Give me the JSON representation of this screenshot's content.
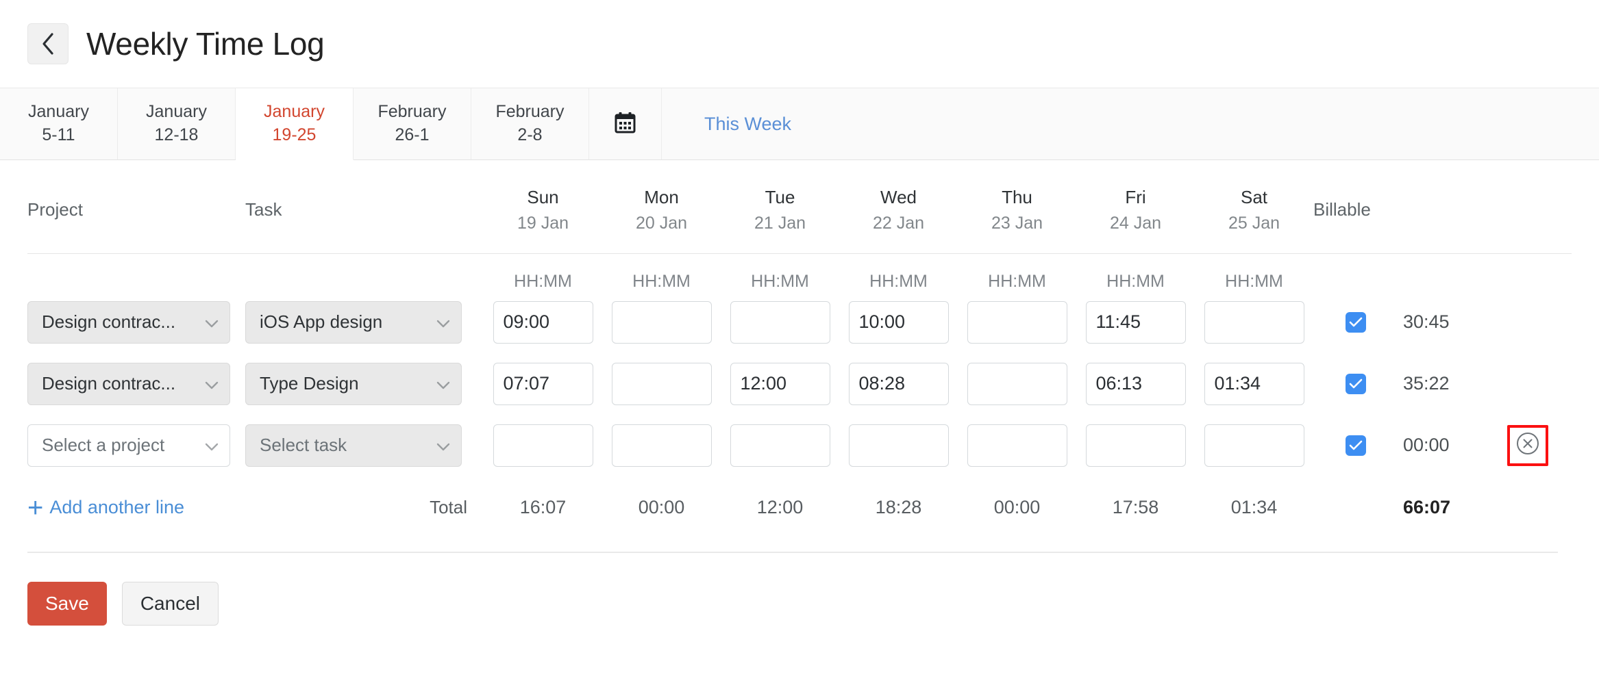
{
  "header": {
    "title": "Weekly Time Log",
    "back_icon": "chevron-left-icon"
  },
  "tabs": {
    "items": [
      {
        "month": "January",
        "range": "5-11",
        "active": false
      },
      {
        "month": "January",
        "range": "12-18",
        "active": false
      },
      {
        "month": "January",
        "range": "19-25",
        "active": true
      },
      {
        "month": "February",
        "range": "26-1",
        "active": false
      },
      {
        "month": "February",
        "range": "2-8",
        "active": false
      }
    ],
    "calendar_icon": "calendar-icon",
    "this_week_label": "This Week",
    "active_color": "#d2462f",
    "link_color": "#5a8fd6"
  },
  "table": {
    "headers": {
      "project": "Project",
      "task": "Task",
      "billable": "Billable",
      "days": [
        {
          "name": "Sun",
          "date": "19 Jan"
        },
        {
          "name": "Mon",
          "date": "20 Jan"
        },
        {
          "name": "Tue",
          "date": "21 Jan"
        },
        {
          "name": "Wed",
          "date": "22 Jan"
        },
        {
          "name": "Thu",
          "date": "23 Jan"
        },
        {
          "name": "Fri",
          "date": "24 Jan"
        },
        {
          "name": "Sat",
          "date": "25 Jan"
        }
      ]
    },
    "time_hint": "HH:MM",
    "rows": [
      {
        "project": "Design contrac...",
        "task": "iOS App design",
        "project_placeholder": false,
        "task_placeholder": false,
        "times": [
          "09:00",
          "",
          "",
          "10:00",
          "",
          "11:45",
          ""
        ],
        "billable": true,
        "total": "30:45",
        "deletable": false
      },
      {
        "project": "Design contrac...",
        "task": "Type Design",
        "project_placeholder": false,
        "task_placeholder": false,
        "times": [
          "07:07",
          "",
          "12:00",
          "08:28",
          "",
          "06:13",
          "01:34"
        ],
        "billable": true,
        "total": "35:22",
        "deletable": false
      },
      {
        "project": "Select a project",
        "task": "Select task",
        "project_placeholder": true,
        "task_placeholder": true,
        "times": [
          "",
          "",
          "",
          "",
          "",
          "",
          ""
        ],
        "billable": true,
        "total": "00:00",
        "deletable": true,
        "delete_icon": "circle-x-icon"
      }
    ],
    "totals": {
      "add_line_label": "Add another line",
      "add_icon": "plus-icon",
      "label": "Total",
      "days": [
        "16:07",
        "00:00",
        "12:00",
        "18:28",
        "00:00",
        "17:58",
        "01:34"
      ],
      "grand_total": "66:07"
    }
  },
  "footer": {
    "save_label": "Save",
    "cancel_label": "Cancel",
    "save_color": "#d44f3c"
  }
}
